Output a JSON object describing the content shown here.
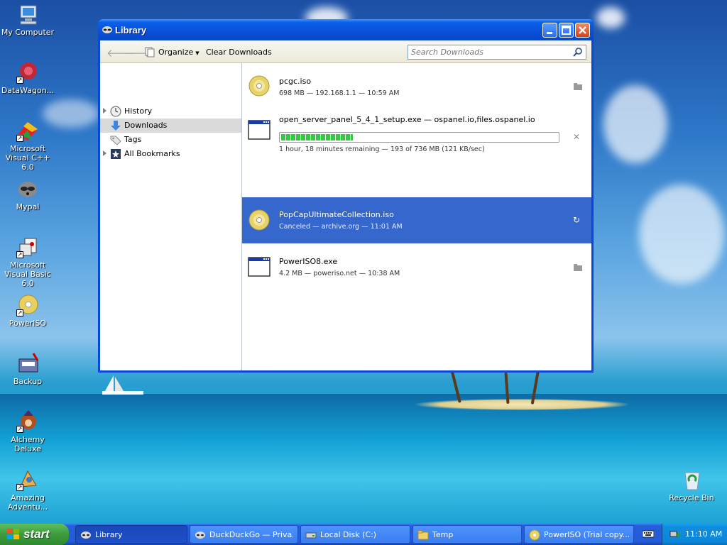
{
  "desktop": {
    "icons": [
      {
        "label": "My Computer"
      },
      {
        "label": "DataWagon..."
      },
      {
        "label": "Microsoft Visual C++ 6.0"
      },
      {
        "label": "Mypal"
      },
      {
        "label": "Microsoft Visual Basic 6.0"
      },
      {
        "label": "PowerISO"
      },
      {
        "label": "Backup"
      },
      {
        "label": "Alchemy Deluxe"
      },
      {
        "label": "Amazing Adventu..."
      },
      {
        "label": "Recycle Bin"
      }
    ]
  },
  "window": {
    "title": "Library",
    "toolbar": {
      "organize_label": "Organize",
      "clear_label": "Clear Downloads",
      "search_placeholder": "Search Downloads"
    },
    "sidebar": {
      "items": [
        {
          "label": "History"
        },
        {
          "label": "Downloads"
        },
        {
          "label": "Tags"
        },
        {
          "label": "All Bookmarks"
        }
      ]
    },
    "downloads": [
      {
        "name": "pcgc.iso",
        "status": "698 MB — 192.168.1.1 — 10:59 AM",
        "icon": "disc-icon",
        "action": "folder-icon"
      },
      {
        "name": "open_server_panel_5_4_1_setup.exe — ospanel.io,files.ospanel.io",
        "status": "1 hour, 18 minutes remaining — 193 of 736 MB (121 KB/sec)",
        "icon": "window-app-icon",
        "action": "cancel-icon",
        "progress": 0.26
      },
      {
        "name": "PopCapUltimateCollection.iso",
        "status": "Canceled — archive.org — 11:01 AM",
        "icon": "disc-icon",
        "action": "retry-icon"
      },
      {
        "name": "PowerISO8.exe",
        "status": "4.2 MB — poweriso.net — 10:38 AM",
        "icon": "window-app-icon",
        "action": "folder-icon"
      }
    ]
  },
  "taskbar": {
    "start_label": "start",
    "tasks": [
      {
        "label": "Library"
      },
      {
        "label": "DuckDuckGo — Priva..."
      },
      {
        "label": "Local Disk (C:)"
      },
      {
        "label": "Temp"
      },
      {
        "label": "PowerISO (Trial copy..."
      }
    ],
    "clock": "11:10 AM"
  }
}
